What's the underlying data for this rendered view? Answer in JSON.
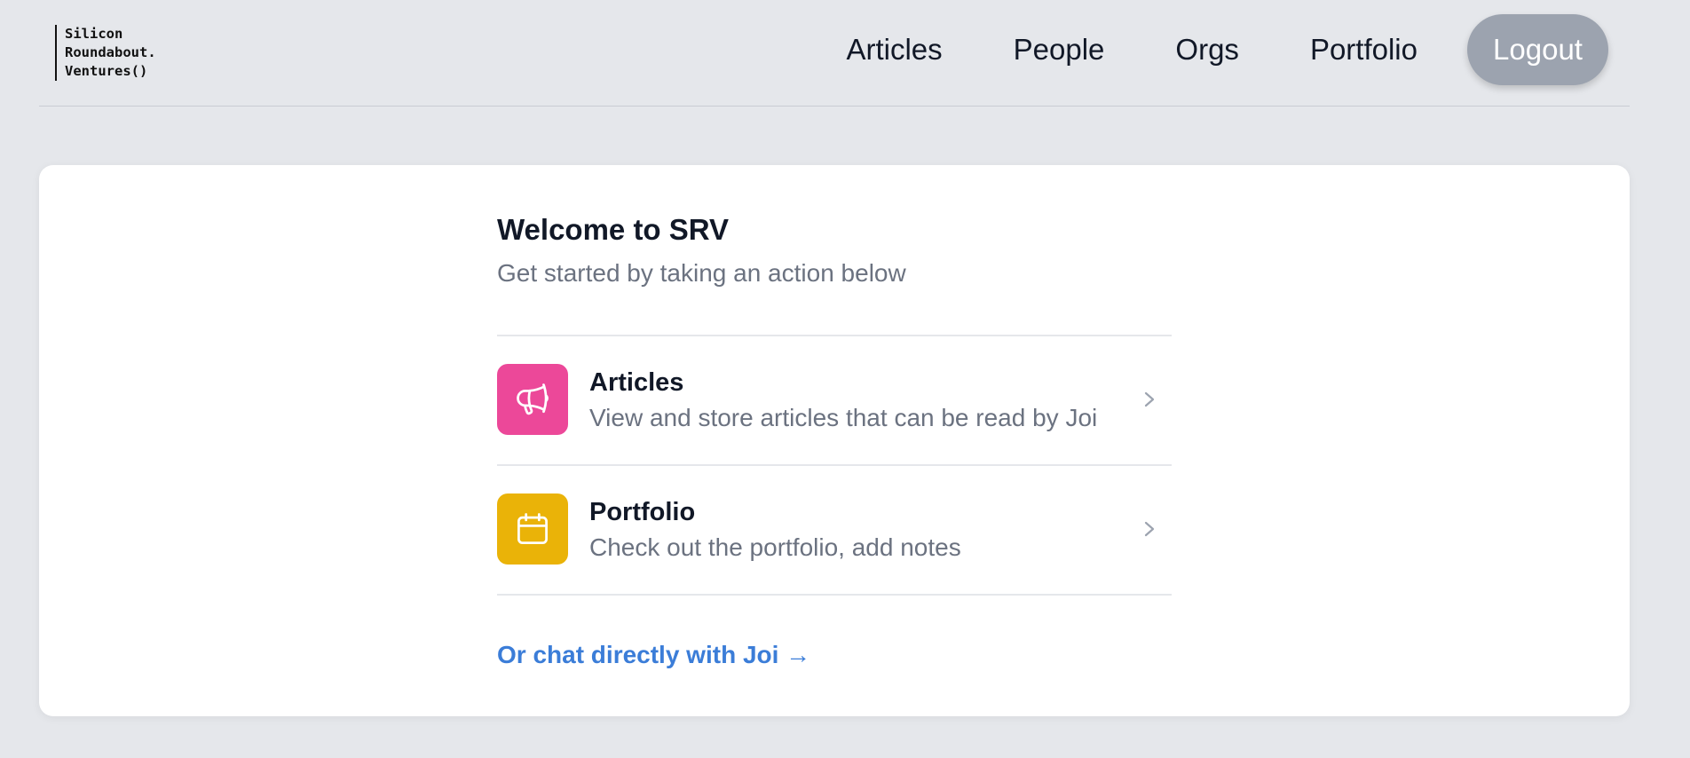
{
  "logo": {
    "lines": [
      "Silicon",
      "Roundabout.",
      "Ventures()"
    ]
  },
  "nav": {
    "items": [
      {
        "label": "Articles"
      },
      {
        "label": "People"
      },
      {
        "label": "Orgs"
      },
      {
        "label": "Portfolio"
      }
    ],
    "logout_label": "Logout"
  },
  "main": {
    "title": "Welcome to SRV",
    "subtitle": "Get started by taking an action below",
    "actions": [
      {
        "title": "Articles",
        "description": "View and store articles that can be read by Joi",
        "icon": "megaphone-icon",
        "color": "#ec4899"
      },
      {
        "title": "Portfolio",
        "description": "Check out the portfolio, add notes",
        "icon": "calendar-icon",
        "color": "#eab308"
      }
    ],
    "chat_link": "Or chat directly with Joi →"
  },
  "colors": {
    "background": "#e5e7eb",
    "card": "#ffffff",
    "logout_button": "#9ca3af",
    "link": "#3b7dd8"
  }
}
